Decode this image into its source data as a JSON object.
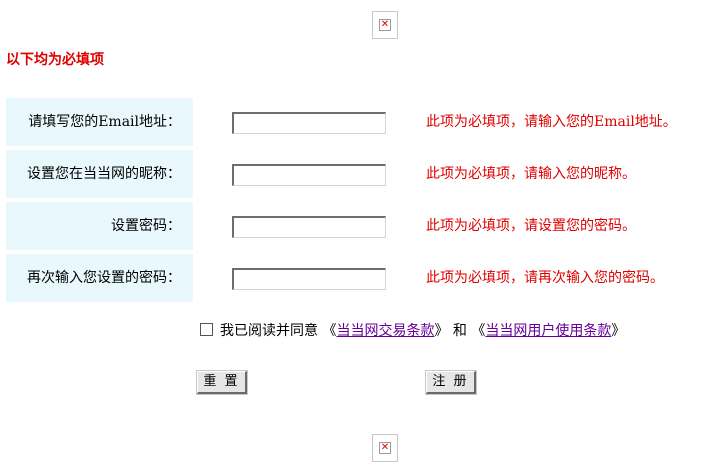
{
  "heading": "以下均为必填项",
  "broken_image_glyph": "✕",
  "fields": [
    {
      "label": "请填写您的Email地址：",
      "value": "",
      "hint": "此项为必填项，请输入您的Email地址。"
    },
    {
      "label": "设置您在当当网的昵称：",
      "value": "",
      "hint": "此项为必填项，请输入您的昵称。"
    },
    {
      "label": "设置密码：",
      "value": "",
      "hint": "此项为必填项，请设置您的密码。"
    },
    {
      "label": "再次输入您设置的密码：",
      "value": "",
      "hint": "此项为必填项，请再次输入您的密码。"
    }
  ],
  "agreement": {
    "checked": false,
    "prefix": "我已阅读并同意",
    "open_quote": "《",
    "close_quote": "》",
    "link1": "当当网交易条款",
    "conjunction": "和",
    "link2": "当当网用户使用条款"
  },
  "buttons": {
    "reset": "重 置",
    "register": "注 册"
  },
  "colors": {
    "required_red": "#e00000",
    "label_bg": "#e8f8fc",
    "link_visited": "#660099"
  }
}
